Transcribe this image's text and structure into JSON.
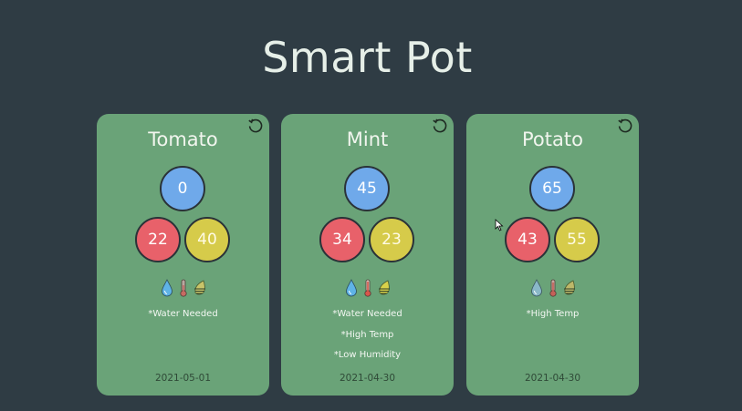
{
  "app": {
    "title": "Smart Pot"
  },
  "colors": {
    "background": "#2f3c44",
    "card": "#6aa378",
    "water": "#6fa9ea",
    "temperature": "#e8616a",
    "humidity": "#d6cb4a"
  },
  "icons": [
    "refresh-icon",
    "water-drop-icon",
    "thermometer-icon",
    "humidity-leaf-icon"
  ],
  "plants": [
    {
      "name": "Tomato",
      "water": "0",
      "temperature": "22",
      "humidity": "40",
      "warnings": [
        "*Water Needed"
      ],
      "date": "2021-05-01"
    },
    {
      "name": "Mint",
      "water": "45",
      "temperature": "34",
      "humidity": "23",
      "warnings": [
        "*Water Needed",
        "*High Temp",
        "*Low Humidity"
      ],
      "date": "2021-04-30"
    },
    {
      "name": "Potato",
      "water": "65",
      "temperature": "43",
      "humidity": "55",
      "warnings": [
        "*High Temp"
      ],
      "date": "2021-04-30"
    }
  ]
}
